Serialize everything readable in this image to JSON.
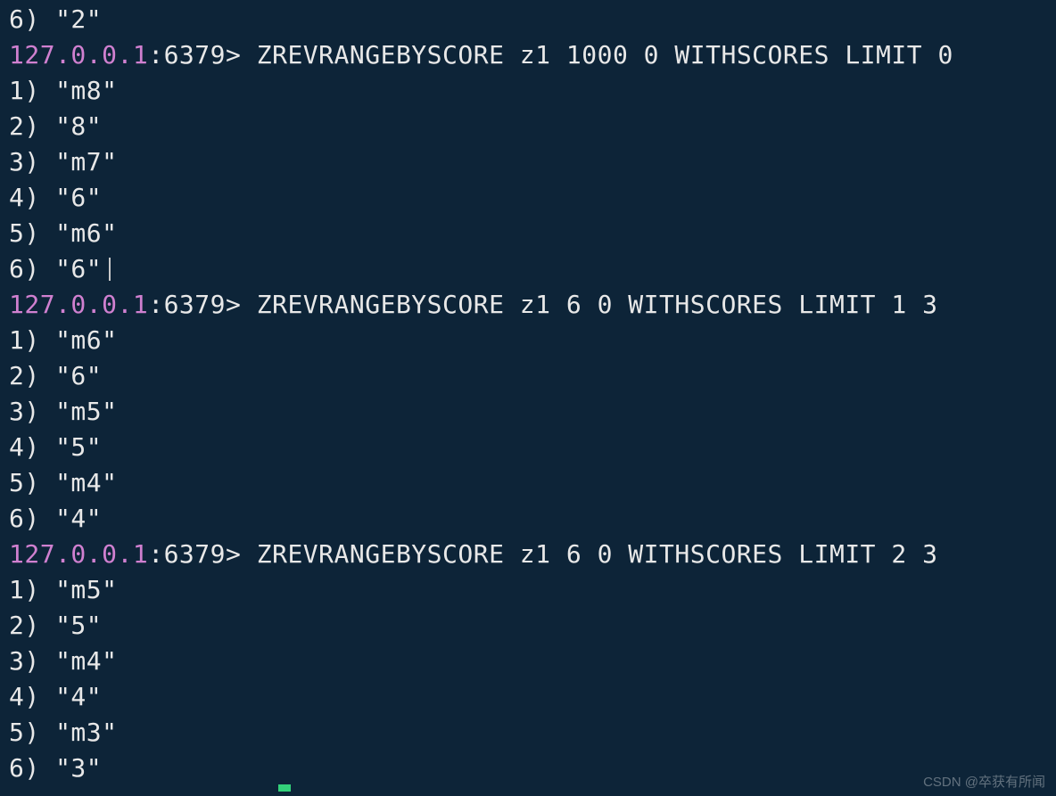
{
  "prompt": {
    "host": "127.0.0.1",
    "port": ":6379>"
  },
  "blocks": [
    {
      "results": [
        {
          "idx": "6)",
          "val": "\"2\""
        }
      ]
    },
    {
      "command": " ZREVRANGEBYSCORE z1 1000 0 WITHSCORES LIMIT 0 ",
      "results": [
        {
          "idx": "1)",
          "val": "\"m8\""
        },
        {
          "idx": "2)",
          "val": "\"8\""
        },
        {
          "idx": "3)",
          "val": "\"m7\""
        },
        {
          "idx": "4)",
          "val": "\"6\""
        },
        {
          "idx": "5)",
          "val": "\"m6\""
        },
        {
          "idx": "6)",
          "val": "\"6\"",
          "cursor": true
        }
      ]
    },
    {
      "command": " ZREVRANGEBYSCORE z1 6 0 WITHSCORES LIMIT 1 3",
      "results": [
        {
          "idx": "1)",
          "val": "\"m6\""
        },
        {
          "idx": "2)",
          "val": "\"6\""
        },
        {
          "idx": "3)",
          "val": "\"m5\""
        },
        {
          "idx": "4)",
          "val": "\"5\""
        },
        {
          "idx": "5)",
          "val": "\"m4\""
        },
        {
          "idx": "6)",
          "val": "\"4\""
        }
      ]
    },
    {
      "command": " ZREVRANGEBYSCORE z1 6 0 WITHSCORES LIMIT 2 3",
      "results": [
        {
          "idx": "1)",
          "val": "\"m5\""
        },
        {
          "idx": "2)",
          "val": "\"5\""
        },
        {
          "idx": "3)",
          "val": "\"m4\""
        },
        {
          "idx": "4)",
          "val": "\"4\""
        },
        {
          "idx": "5)",
          "val": "\"m3\""
        },
        {
          "idx": "6)",
          "val": "\"3\""
        }
      ]
    }
  ],
  "watermark": "CSDN @卒获有所闻"
}
